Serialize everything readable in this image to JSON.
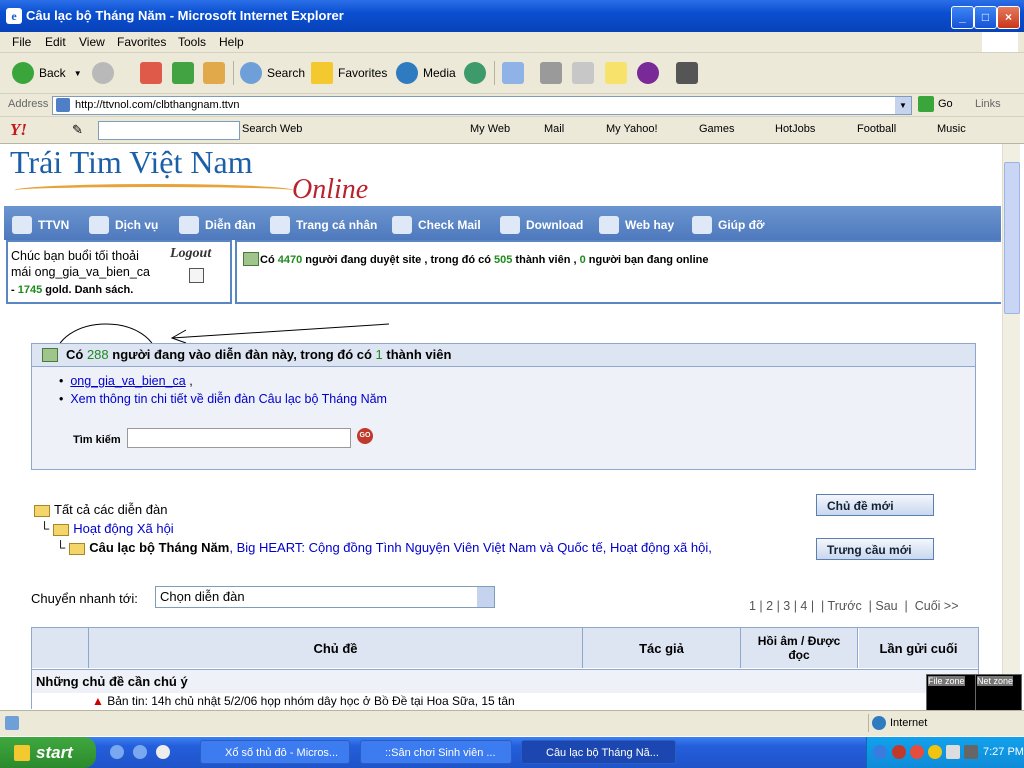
{
  "window": {
    "title": "Câu lạc bộ Tháng Năm - Microsoft Internet Explorer",
    "min": "_",
    "max": "□",
    "close": "×"
  },
  "menu": [
    "File",
    "Edit",
    "View",
    "Favorites",
    "Tools",
    "Help"
  ],
  "toolbar": {
    "back": "Back",
    "search": "Search",
    "favorites": "Favorites",
    "media": "Media"
  },
  "address": {
    "label": "Address",
    "url": "http://ttvnol.com/clbthangnam.ttvn",
    "go": "Go",
    "links": "Links"
  },
  "yahoo": {
    "search_web": "Search Web",
    "items": [
      "My Web",
      "Mail",
      "My Yahoo!",
      "Games",
      "HotJobs",
      "Football",
      "Music"
    ]
  },
  "site": {
    "logo_main": "Trái Tim Việt Nam",
    "logo_sub": "Online",
    "nav": [
      "TTVN",
      "Dịch vụ",
      "Diễn đàn",
      "Trang cá nhân",
      "Check Mail",
      "Download",
      "Web hay",
      "Giúp đỡ"
    ],
    "user": {
      "greeting": "Chúc bạn buổi tối thoải mái ong_gia_va_bien_ca",
      "logout": "Logout",
      "gold_prefix": "- ",
      "gold": "1745",
      "gold_suffix": " gold. Danh sách."
    },
    "status": {
      "p1": "Có ",
      "n1": "4470",
      "p2": " người đang duyệt site , trong đó có ",
      "n2": "505",
      "p3": " thành viên , ",
      "n3": "0",
      "p4": " người bạn đang online"
    }
  },
  "forum_online": {
    "p1": "Có ",
    "n1": "288",
    "p2": " người đang vào diễn đàn này, trong đó có ",
    "n2": "1",
    "p3": " thành viên",
    "member": "ong_gia_va_bien_ca",
    "member_suffix": " ,",
    "detail_link": "Xem thông tin chi tiết về diễn đàn Câu lạc bộ Tháng Năm",
    "search_label": "Tìm kiếm",
    "go": "GO"
  },
  "breadcrumb": {
    "all": "Tất cả các diễn đàn",
    "parent": "Hoạt động Xã hội",
    "current": "Câu lạc bộ Tháng Năm",
    "siblings": ", Big HEART: Cộng đồng Tình Nguyện Viên Việt Nam và Quốc tế, Hoạt động xã hội,"
  },
  "buttons": {
    "new_topic": "Chủ đề mới",
    "new_poll": "Trưng cầu mới"
  },
  "jump": {
    "label": "Chuyển nhanh tới:",
    "selected": "Chọn diễn đàn"
  },
  "pagination": {
    "text": "1 | 2 | 3 | 4 |  | Trước  | Sau  |  Cuối >>"
  },
  "table": {
    "headers": [
      "Chủ đề",
      "Tác giả",
      "Hồi âm / Được đọc",
      "Lần gửi cuối"
    ],
    "section": "Những chủ đề cần chú ý",
    "first_row": "Bản tin: 14h chủ nhật 5/2/06 họp nhóm dây học ở Bồ Đề tại Hoa Sữa, 15 tân"
  },
  "statusbar": {
    "zone": "Internet",
    "file_zone": "File zone",
    "net_zone": "Net zone"
  },
  "taskbar": {
    "start": "start",
    "tasks": [
      "Xổ số thủ đô - Micros...",
      "::Sân chơi Sinh viên ...",
      "Câu lạc bộ Tháng Nă..."
    ],
    "clock": "7:27 PM"
  },
  "colors": {
    "accent_blue": "#5b86c4",
    "online_green": "#1f8a1f",
    "titlebar": "#0a4fd1"
  }
}
